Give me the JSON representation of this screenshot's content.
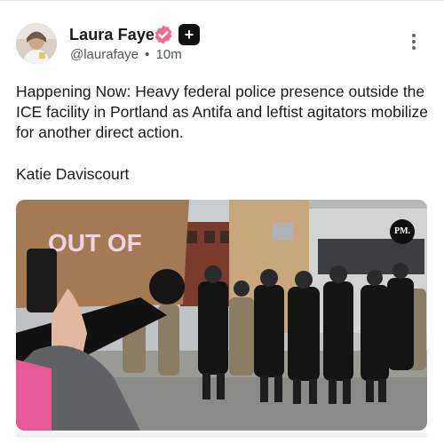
{
  "post": {
    "author_name": "Laura Faye",
    "handle": "@laurafaye",
    "separator": "•",
    "time_ago": "10m",
    "plus_badge": "+",
    "text": "Happening Now: Heavy federal police presence outside the ICE facility in Portland as Antifa and leftist agitators mobilize for another direct action.",
    "credit": "Katie Daviscourt"
  },
  "media": {
    "sign_text": "OUT OF",
    "watermark": "PM."
  },
  "icons": {
    "verified": "verified-badge-icon",
    "menu": "more-vertical-icon"
  },
  "colors": {
    "verified": "#f36b8d",
    "uniform": "#141414",
    "camo": "#8b7d63"
  }
}
